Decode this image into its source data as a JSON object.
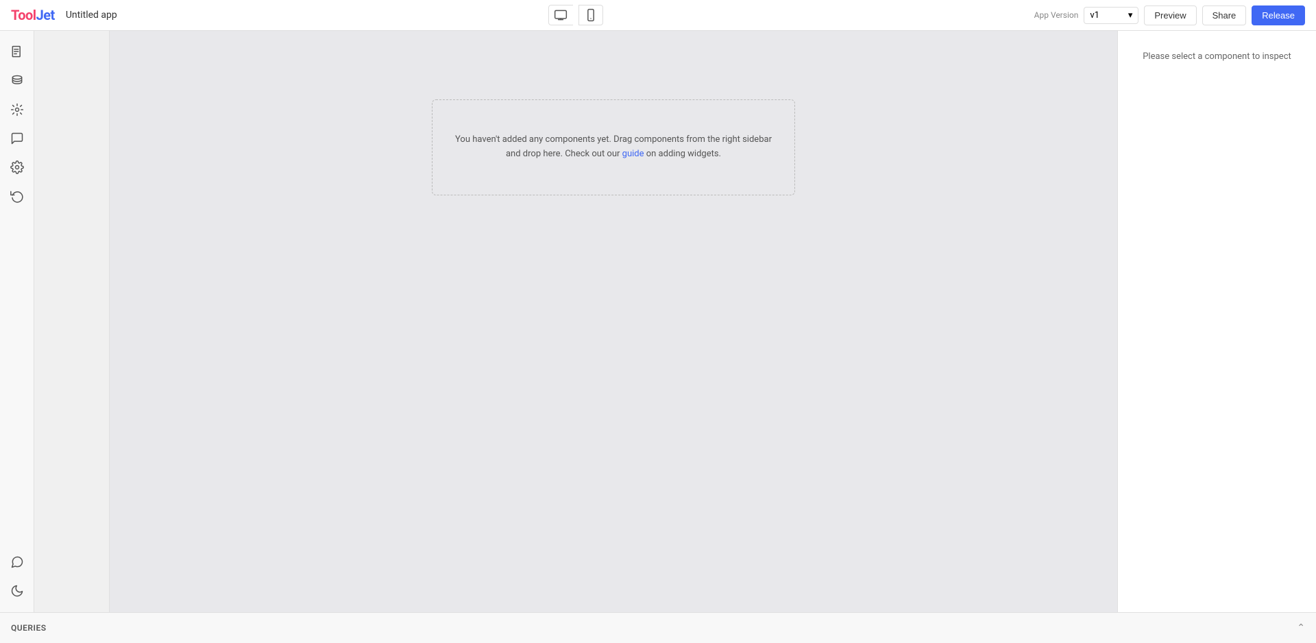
{
  "header": {
    "logo_text": "ToolJet",
    "app_title": "Untitled app",
    "app_version_label": "App Version",
    "version_value": "v1",
    "preview_label": "Preview",
    "share_label": "Share",
    "release_label": "Release"
  },
  "canvas": {
    "empty_message_line1": "You haven't added any components yet. Drag components from the right sidebar",
    "empty_message_line2": "and drop here. Check out our ",
    "guide_link_text": "guide",
    "empty_message_line3": " on adding widgets."
  },
  "right_panel": {
    "inspect_text": "Please select a component to inspect"
  },
  "queries_panel": {
    "label": "QUERIES",
    "collapse_icon": "chevron-up"
  },
  "sidebar": {
    "icons": [
      {
        "name": "pages-icon",
        "symbol": "📄",
        "title": "Pages"
      },
      {
        "name": "database-icon",
        "symbol": "🗄",
        "title": "Database"
      },
      {
        "name": "components-icon",
        "symbol": "⚙",
        "title": "Components"
      },
      {
        "name": "comments-icon",
        "symbol": "💬",
        "title": "Comments"
      },
      {
        "name": "settings-icon",
        "symbol": "⚙",
        "title": "Settings"
      },
      {
        "name": "undo-icon",
        "symbol": "↩",
        "title": "Undo"
      }
    ],
    "bottom_icons": [
      {
        "name": "chat-icon",
        "symbol": "💬",
        "title": "Chat"
      },
      {
        "name": "theme-icon",
        "symbol": "🌙",
        "title": "Theme"
      }
    ]
  }
}
